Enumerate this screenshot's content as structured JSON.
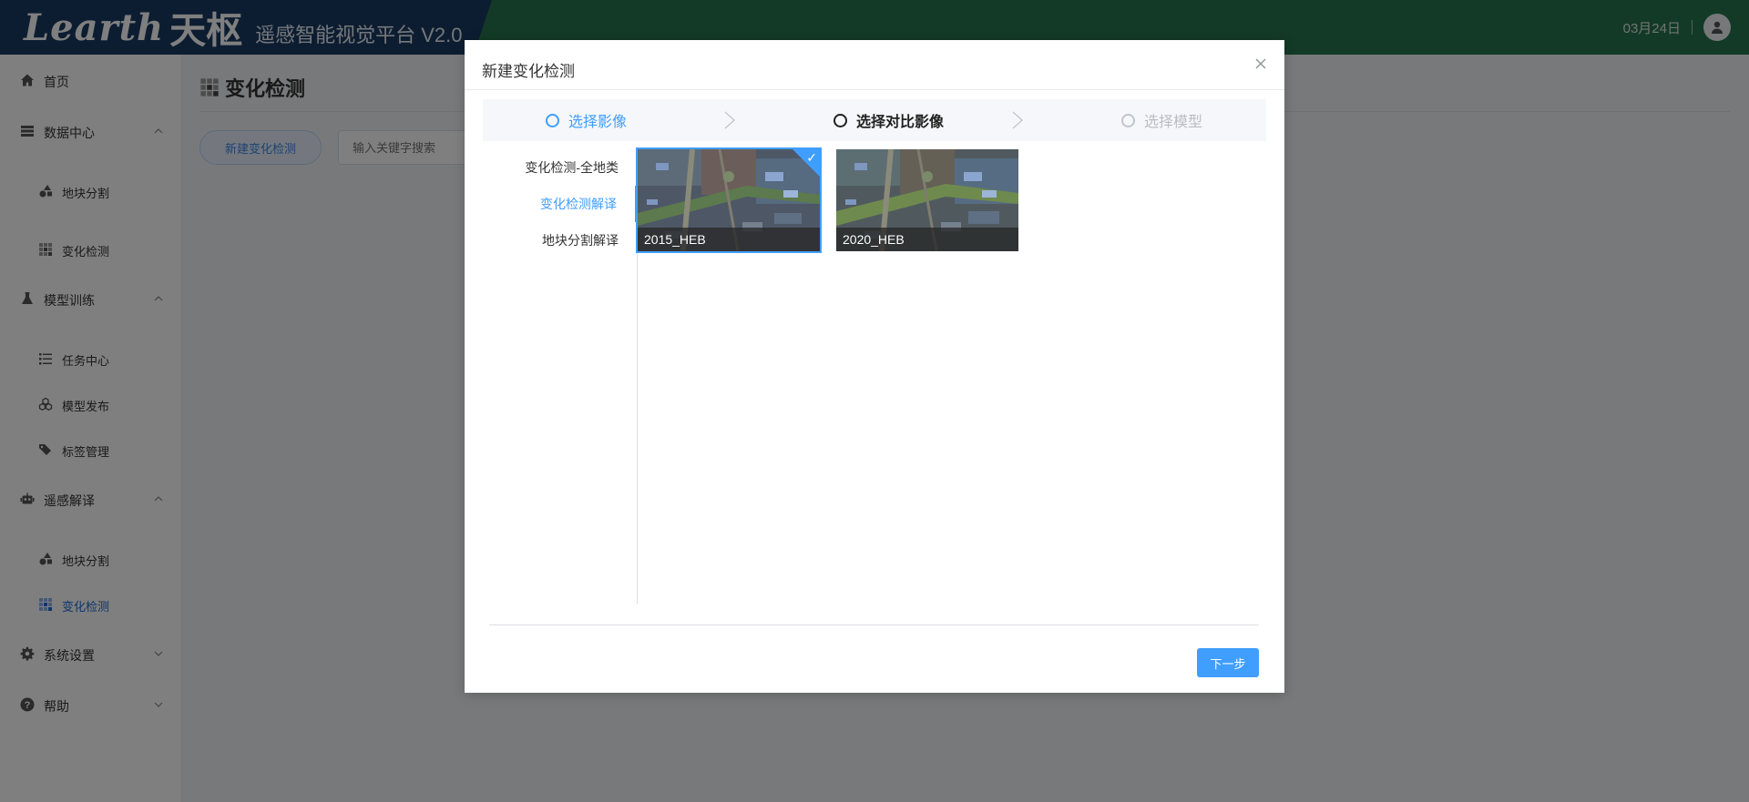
{
  "header": {
    "brand": "Learth",
    "brand_cn": "天枢",
    "subtitle": "遥感智能视觉平台 V2.0",
    "date": "03月24日"
  },
  "sidebar": {
    "home": "首页",
    "data_center": "数据中心",
    "data_center_items": [
      "地块分割",
      "变化检测"
    ],
    "model_training": "模型训练",
    "model_training_items": [
      "任务中心",
      "模型发布",
      "标签管理"
    ],
    "rs_interpretation": "遥感解译",
    "rs_interpretation_items": [
      "地块分割",
      "变化检测"
    ],
    "system_settings": "系统设置",
    "help": "帮助"
  },
  "main": {
    "page_title": "变化检测",
    "new_button": "新建变化检测",
    "search_placeholder": "输入关键字搜索"
  },
  "modal": {
    "title": "新建变化检测",
    "steps": [
      "选择影像",
      "选择对比影像",
      "选择模型"
    ],
    "categories": [
      "变化检测-全地类",
      "变化检测解译",
      "地块分割解译"
    ],
    "active_category": "变化检测解译",
    "images": [
      {
        "name": "2015_HEB",
        "selected": true
      },
      {
        "name": "2020_HEB",
        "selected": false
      }
    ],
    "next_button": "下一步"
  },
  "colors": {
    "primary": "#409eff",
    "header_green": "#27744f",
    "header_navy": "#1b3a63"
  }
}
